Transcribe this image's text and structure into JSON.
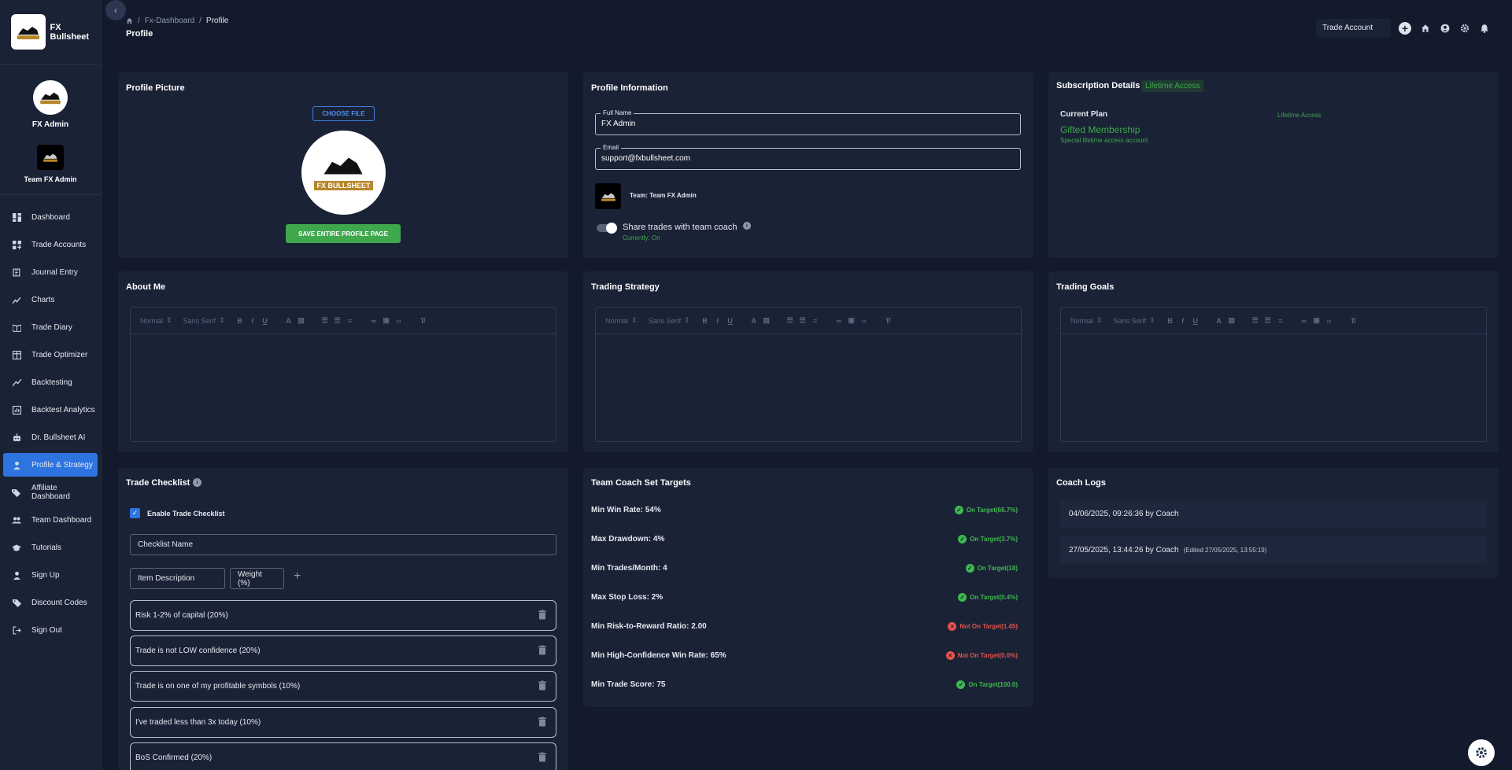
{
  "sidebar": {
    "brand": "FX Bullsheet",
    "user_name": "FX Admin",
    "team_name": "Team FX Admin",
    "items": [
      {
        "label": "Dashboard",
        "icon": "dashboard-icon"
      },
      {
        "label": "Trade Accounts",
        "icon": "grid-plus-icon"
      },
      {
        "label": "Journal Entry",
        "icon": "journal-icon"
      },
      {
        "label": "Charts",
        "icon": "line-chart-icon"
      },
      {
        "label": "Trade Diary",
        "icon": "book-icon"
      },
      {
        "label": "Trade Optimizer",
        "icon": "table-icon"
      },
      {
        "label": "Backtesting",
        "icon": "trend-icon"
      },
      {
        "label": "Backtest Analytics",
        "icon": "analytics-icon"
      },
      {
        "label": "Dr. Bullsheet AI",
        "icon": "robot-icon"
      },
      {
        "label": "Profile & Strategy",
        "icon": "person-icon",
        "active": true
      },
      {
        "label": "Affiliate Dashboard",
        "icon": "tag-icon"
      },
      {
        "label": "Team Dashboard",
        "icon": "people-icon"
      },
      {
        "label": "Tutorials",
        "icon": "graduation-cap-icon"
      },
      {
        "label": "Sign Up",
        "icon": "person-icon"
      },
      {
        "label": "Discount Codes",
        "icon": "tag-icon"
      },
      {
        "label": "Sign Out",
        "icon": "logout-icon"
      }
    ]
  },
  "breadcrumb": {
    "level1": "Fx-Dashboard",
    "level2": "Profile"
  },
  "page_title": "Profile",
  "topbar": {
    "trade_account": "Trade Account",
    "plus": "+"
  },
  "logo": {
    "text": "FX BULLSHEET"
  },
  "profile_picture": {
    "title": "Profile Picture",
    "choose_file": "CHOOSE FILE",
    "save_button": "SAVE ENTIRE PROFILE PAGE"
  },
  "profile_info": {
    "title": "Profile Information",
    "full_name_label": "Full Name",
    "full_name_value": "FX Admin",
    "email_label": "Email",
    "email_value": "support@fxbullsheet.com",
    "team_label": "Team: Team FX Admin",
    "share_label": "Share trades with team coach",
    "share_status": "Currently: On"
  },
  "subscription": {
    "title": "Subscription Details",
    "badge": "Lifetime Access",
    "current_plan_label": "Current Plan",
    "current_plan_right": "Lifetime Access",
    "plan_name": "Gifted Membership",
    "plan_desc": "Special lifetime access account"
  },
  "editors": {
    "about_me": "About Me",
    "trading_strategy": "Trading Strategy",
    "trading_goals": "Trading Goals",
    "toolbar_format": "Normal",
    "toolbar_font": "Sans Serif"
  },
  "checklist": {
    "title": "Trade Checklist",
    "enable_label": "Enable Trade Checklist",
    "name_placeholder": "Checklist Name",
    "item_placeholder": "Item Description",
    "weight_placeholder": "Weight (%)",
    "add": "+",
    "items": [
      "Risk 1-2% of capital (20%)",
      "Trade is not LOW confidence (20%)",
      "Trade is on one of my profitable symbols (10%)",
      "I've traded less than 3x today (10%)",
      "BoS Confirmed (20%)"
    ]
  },
  "targets": {
    "title": "Team Coach Set Targets",
    "rows": [
      {
        "label": "Min Win Rate: 54%",
        "status": "On Target(66.7%)",
        "ok": true
      },
      {
        "label": "Max Drawdown: 4%",
        "status": "On Target(3.7%)",
        "ok": true
      },
      {
        "label": "Min Trades/Month: 4",
        "status": "On Target(18)",
        "ok": true
      },
      {
        "label": "Max Stop Loss: 2%",
        "status": "On Target(0.4%)",
        "ok": true
      },
      {
        "label": "Min Risk-to-Reward Ratio: 2.00",
        "status": "Not On Target(1.45)",
        "ok": false
      },
      {
        "label": "Min High-Confidence Win Rate: 65%",
        "status": "Not On Target(0.0%)",
        "ok": false
      },
      {
        "label": "Min Trade Score: 75",
        "status": "On Target(100.0)",
        "ok": true
      }
    ]
  },
  "coach_logs": {
    "title": "Coach Logs",
    "entries": [
      {
        "text": "04/06/2025, 09:26:36 by Coach",
        "edited": ""
      },
      {
        "text": "27/05/2025, 13:44:26 by Coach",
        "edited": "(Edited 27/05/2025, 13:55:19)"
      }
    ]
  },
  "colors": {
    "accent": "#2d74e0",
    "success": "#3fa84d",
    "danger": "#e5534b",
    "background": "#131a2c",
    "card": "#1a2236"
  }
}
